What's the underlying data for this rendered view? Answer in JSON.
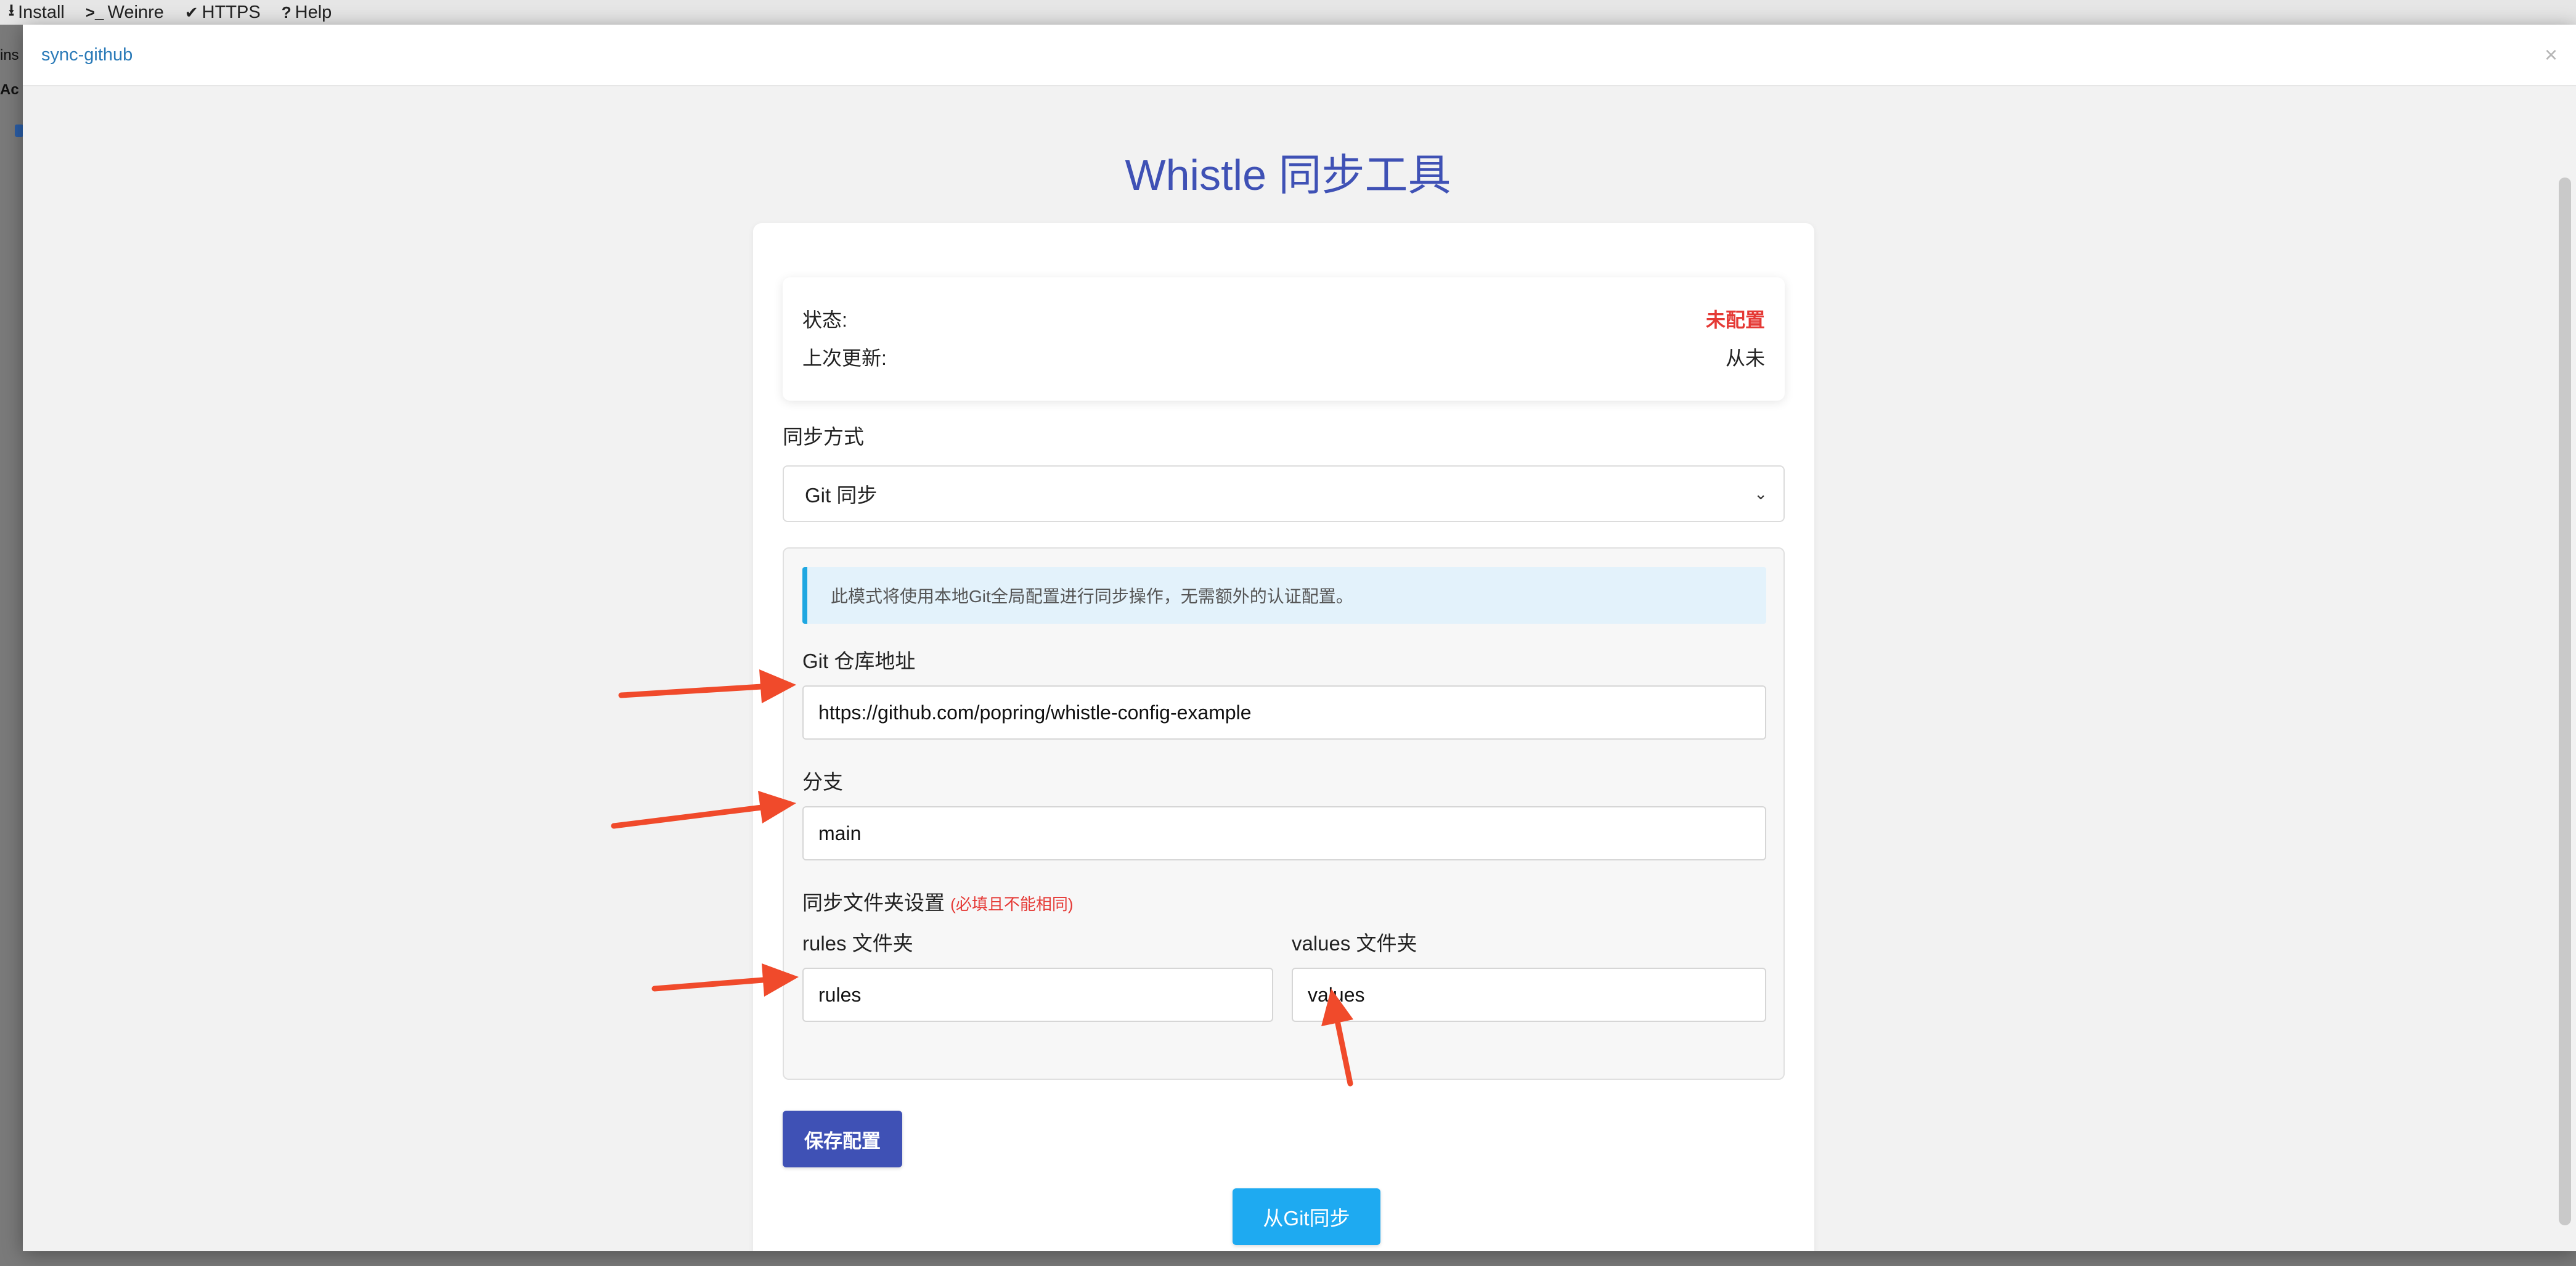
{
  "background": {
    "toolbar": [
      {
        "icon": "download-icon",
        "glyph": "⭳",
        "label": "Install"
      },
      {
        "icon": "terminal-icon",
        "glyph": ">_",
        "label": "Weinre"
      },
      {
        "icon": "check-icon",
        "glyph": "✔",
        "label": "HTTPS"
      },
      {
        "icon": "help-circle-icon",
        "glyph": "?",
        "label": "Help"
      }
    ],
    "left_text_1": "ins",
    "left_text_2": "Ac"
  },
  "modal": {
    "title": "sync-github",
    "close_glyph": "×"
  },
  "page": {
    "title": "Whistle 同步工具"
  },
  "status": {
    "state_label": "状态:",
    "state_value": "未配置",
    "updated_label": "上次更新:",
    "updated_value": "从未"
  },
  "sync_method": {
    "label": "同步方式",
    "selected": "Git 同步",
    "chevron": "⌄"
  },
  "git": {
    "info": "此模式将使用本地Git全局配置进行同步操作，无需额外的认证配置。",
    "repo_label": "Git 仓库地址",
    "repo_value": "https://github.com/popring/whistle-config-example",
    "branch_label": "分支",
    "branch_value": "main",
    "folder_settings_label": "同步文件夹设置",
    "folder_settings_hint": "(必填且不能相同)",
    "rules_label": "rules 文件夹",
    "rules_value": "rules",
    "values_label": "values 文件夹",
    "values_value": "values"
  },
  "buttons": {
    "save": "保存配置",
    "sync_from_git": "从Git同步"
  },
  "colors": {
    "primary": "#3f51b5",
    "sync_button": "#1eaaf1",
    "status_red": "#e53935",
    "annotation_arrow": "#f04a2b",
    "info_border": "#1ea7e1"
  }
}
